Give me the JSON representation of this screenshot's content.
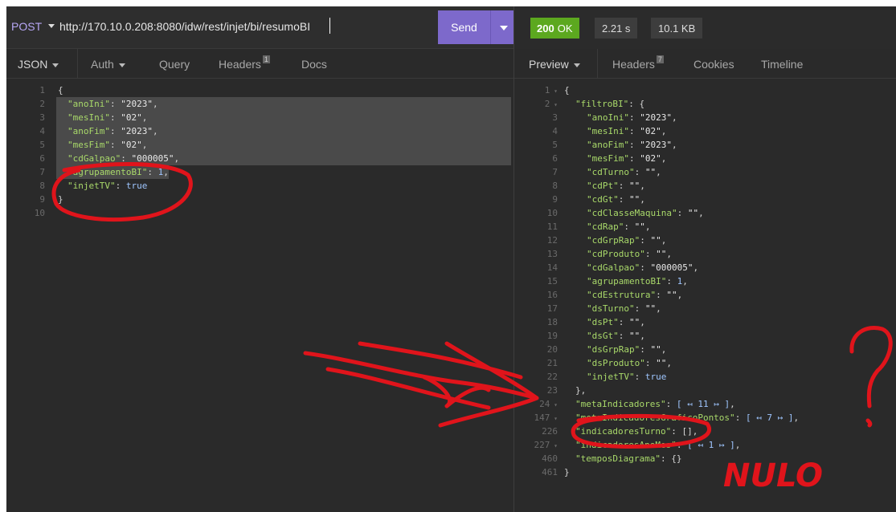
{
  "request": {
    "method": "POST",
    "url": "http://170.10.0.208:8080/idw/rest/injet/bi/resumoBI",
    "send_label": "Send"
  },
  "response": {
    "status_code": "200",
    "status_text": "OK",
    "time": "2.21 s",
    "size": "10.1 KB"
  },
  "left_tabs": {
    "body": "JSON",
    "auth": "Auth",
    "query": "Query",
    "headers": "Headers",
    "headers_count": "1",
    "docs": "Docs"
  },
  "right_tabs": {
    "preview": "Preview",
    "headers": "Headers",
    "headers_count": "7",
    "cookies": "Cookies",
    "timeline": "Timeline"
  },
  "request_body": [
    {
      "n": "1",
      "text": "{"
    },
    {
      "n": "2",
      "key": "\"anoIni\"",
      "val": "\"2023\"",
      "vtype": "str",
      "end": ","
    },
    {
      "n": "3",
      "key": "\"mesIni\"",
      "val": "\"02\"",
      "vtype": "str",
      "end": ","
    },
    {
      "n": "4",
      "key": "\"anoFim\"",
      "val": "\"2023\"",
      "vtype": "str",
      "end": ","
    },
    {
      "n": "5",
      "key": "\"mesFim\"",
      "val": "\"02\"",
      "vtype": "str",
      "end": ","
    },
    {
      "n": "6",
      "key": "\"cdGalpao\"",
      "val": "\"000005\"",
      "vtype": "str",
      "end": ","
    },
    {
      "n": "7",
      "key": "\"agrupamentoBI\"",
      "val": "1",
      "vtype": "num",
      "end": ","
    },
    {
      "n": "8",
      "key": "\"injetTV\"",
      "val": "true",
      "vtype": "bool",
      "end": ""
    },
    {
      "n": "9",
      "text": "}"
    },
    {
      "n": "10",
      "text": ""
    }
  ],
  "response_body": [
    {
      "n": "1",
      "fold": true,
      "indent": 0,
      "text": "{"
    },
    {
      "n": "2",
      "fold": true,
      "indent": 1,
      "key": "\"filtroBI\"",
      "val": "{",
      "vtype": "punct",
      "end": ""
    },
    {
      "n": "3",
      "indent": 2,
      "key": "\"anoIni\"",
      "val": "\"2023\"",
      "vtype": "str",
      "end": ","
    },
    {
      "n": "4",
      "indent": 2,
      "key": "\"mesIni\"",
      "val": "\"02\"",
      "vtype": "str",
      "end": ","
    },
    {
      "n": "5",
      "indent": 2,
      "key": "\"anoFim\"",
      "val": "\"2023\"",
      "vtype": "str",
      "end": ","
    },
    {
      "n": "6",
      "indent": 2,
      "key": "\"mesFim\"",
      "val": "\"02\"",
      "vtype": "str",
      "end": ","
    },
    {
      "n": "7",
      "indent": 2,
      "key": "\"cdTurno\"",
      "val": "\"\"",
      "vtype": "str",
      "end": ","
    },
    {
      "n": "8",
      "indent": 2,
      "key": "\"cdPt\"",
      "val": "\"\"",
      "vtype": "str",
      "end": ","
    },
    {
      "n": "9",
      "indent": 2,
      "key": "\"cdGt\"",
      "val": "\"\"",
      "vtype": "str",
      "end": ","
    },
    {
      "n": "10",
      "indent": 2,
      "key": "\"cdClasseMaquina\"",
      "val": "\"\"",
      "vtype": "str",
      "end": ","
    },
    {
      "n": "11",
      "indent": 2,
      "key": "\"cdRap\"",
      "val": "\"\"",
      "vtype": "str",
      "end": ","
    },
    {
      "n": "12",
      "indent": 2,
      "key": "\"cdGrpRap\"",
      "val": "\"\"",
      "vtype": "str",
      "end": ","
    },
    {
      "n": "13",
      "indent": 2,
      "key": "\"cdProduto\"",
      "val": "\"\"",
      "vtype": "str",
      "end": ","
    },
    {
      "n": "14",
      "indent": 2,
      "key": "\"cdGalpao\"",
      "val": "\"000005\"",
      "vtype": "str",
      "end": ","
    },
    {
      "n": "15",
      "indent": 2,
      "key": "\"agrupamentoBI\"",
      "val": "1",
      "vtype": "num",
      "end": ","
    },
    {
      "n": "16",
      "indent": 2,
      "key": "\"cdEstrutura\"",
      "val": "\"\"",
      "vtype": "str",
      "end": ","
    },
    {
      "n": "17",
      "indent": 2,
      "key": "\"dsTurno\"",
      "val": "\"\"",
      "vtype": "str",
      "end": ","
    },
    {
      "n": "18",
      "indent": 2,
      "key": "\"dsPt\"",
      "val": "\"\"",
      "vtype": "str",
      "end": ","
    },
    {
      "n": "19",
      "indent": 2,
      "key": "\"dsGt\"",
      "val": "\"\"",
      "vtype": "str",
      "end": ","
    },
    {
      "n": "20",
      "indent": 2,
      "key": "\"dsGrpRap\"",
      "val": "\"\"",
      "vtype": "str",
      "end": ","
    },
    {
      "n": "21",
      "indent": 2,
      "key": "\"dsProduto\"",
      "val": "\"\"",
      "vtype": "str",
      "end": ","
    },
    {
      "n": "22",
      "indent": 2,
      "key": "\"injetTV\"",
      "val": "true",
      "vtype": "bool",
      "end": ""
    },
    {
      "n": "23",
      "indent": 1,
      "text": "},"
    },
    {
      "n": "24",
      "fold": true,
      "indent": 1,
      "key": "\"metaIndicadores\"",
      "val": "[ ↤ 11 ↦ ]",
      "vtype": "coll",
      "end": ","
    },
    {
      "n": "147",
      "fold": true,
      "indent": 1,
      "key": "\"metaIndicadoresGraficoPontos\"",
      "val": "[ ↤ 7 ↦ ]",
      "vtype": "coll",
      "end": ","
    },
    {
      "n": "226",
      "indent": 1,
      "key": "\"indicadoresTurno\"",
      "val": "[]",
      "vtype": "punct",
      "end": ","
    },
    {
      "n": "227",
      "fold": true,
      "indent": 1,
      "key": "\"indicadoresAnoMes\"",
      "val": "[ ↤ 1 ↦ ]",
      "vtype": "coll",
      "end": ","
    },
    {
      "n": "460",
      "indent": 1,
      "key": "\"temposDiagrama\"",
      "val": "{}",
      "vtype": "punct",
      "end": ""
    },
    {
      "n": "461",
      "indent": 0,
      "text": "}"
    }
  ],
  "annotation": {
    "label": "NULO",
    "question": "?",
    "color": "#e0141b"
  },
  "colors": {
    "send": "#7d69cb",
    "status_ok": "#5ca81f",
    "method": "#b7a7f5",
    "json_key": "#a9d96a"
  }
}
